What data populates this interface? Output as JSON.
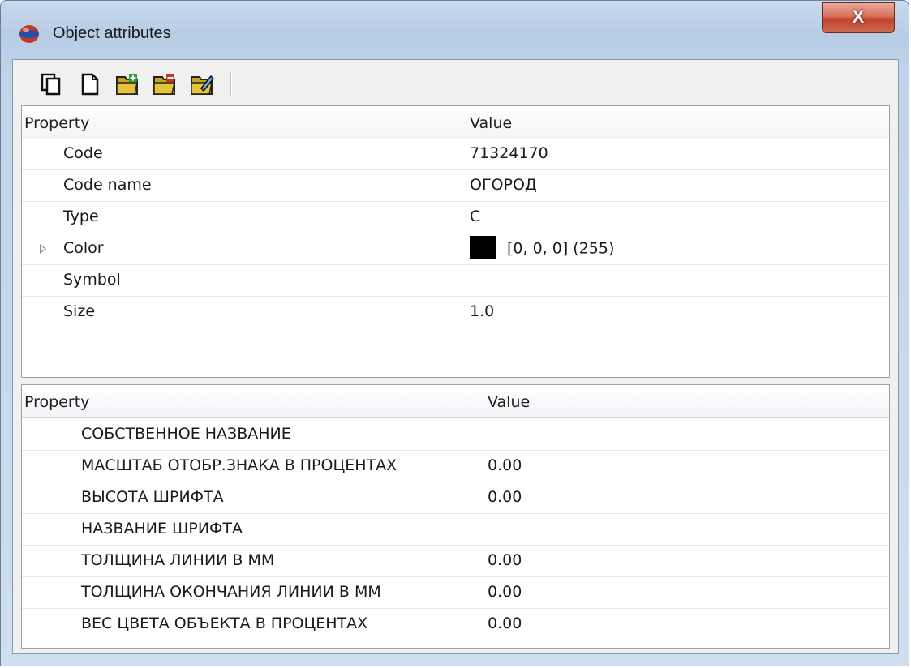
{
  "window": {
    "title": "Object attributes",
    "close_label": "X"
  },
  "toolbar": {
    "buttons": [
      {
        "name": "copy-icon"
      },
      {
        "name": "new-document-icon"
      },
      {
        "name": "folder-add-icon"
      },
      {
        "name": "folder-remove-icon"
      },
      {
        "name": "folder-edit-icon"
      }
    ]
  },
  "properties_grid": {
    "header": {
      "property": "Property",
      "value": "Value"
    },
    "rows": [
      {
        "name": "Code",
        "value": "71324170"
      },
      {
        "name": "Code name",
        "value": "ОГОРОД"
      },
      {
        "name": "Type",
        "value": "C"
      },
      {
        "name": "Color",
        "value": "[0, 0, 0] (255)",
        "swatch_color": "#000000",
        "expandable": true
      },
      {
        "name": "Symbol",
        "value": ""
      },
      {
        "name": "Size",
        "value": "1.0"
      }
    ]
  },
  "attributes_grid": {
    "header": {
      "property": "Property",
      "value": "Value"
    },
    "rows": [
      {
        "name": "СОБСТВЕННОЕ НАЗВАНИЕ",
        "value": ""
      },
      {
        "name": "МАСШТАБ ОТОБР.ЗНАКА В ПРОЦЕНТАХ",
        "value": "0.00"
      },
      {
        "name": "ВЫСОТА ШРИФТА",
        "value": "0.00"
      },
      {
        "name": "НАЗВАНИЕ ШРИФТА",
        "value": ""
      },
      {
        "name": "ТОЛЩИНА ЛИНИИ В ММ",
        "value": "0.00"
      },
      {
        "name": "ТОЛЩИНА ОКОНЧАНИЯ ЛИНИИ В ММ",
        "value": "0.00"
      },
      {
        "name": "ВЕС ЦВЕТА ОБЪЕКТА В ПРОЦЕНТАХ",
        "value": "0.00"
      }
    ]
  }
}
